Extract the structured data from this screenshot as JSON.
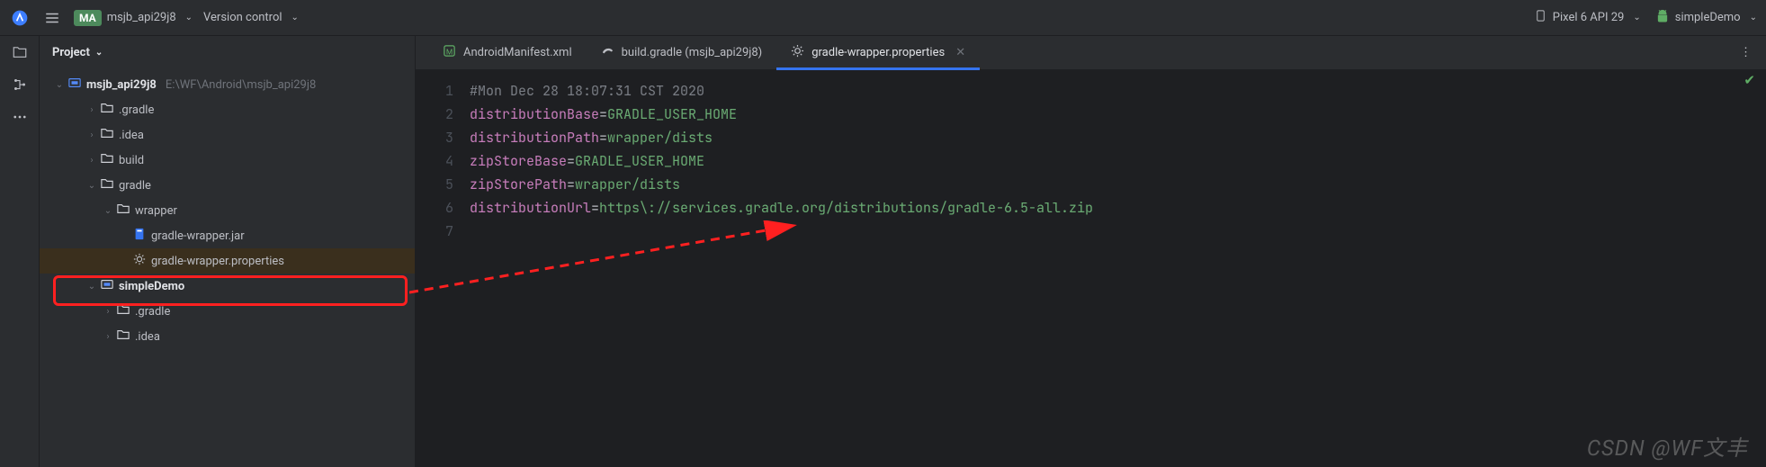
{
  "topbar": {
    "project_badge": "MA",
    "project_name": "msjb_api29j8",
    "version_control": "Version control",
    "device": "Pixel 6 API 29",
    "run_config": "simpleDemo"
  },
  "sidebar": {
    "title": "Project",
    "root": {
      "label": "msjb_api29j8",
      "path": "E:\\WF\\Android\\msjb_api29j8"
    },
    "items": [
      {
        "label": ".gradle",
        "indent": 2,
        "chev": "›",
        "icon": "folder"
      },
      {
        "label": ".idea",
        "indent": 2,
        "chev": "›",
        "icon": "folder"
      },
      {
        "label": "build",
        "indent": 2,
        "chev": "›",
        "icon": "folder"
      },
      {
        "label": "gradle",
        "indent": 2,
        "chev": "⌄",
        "icon": "folder"
      },
      {
        "label": "wrapper",
        "indent": 3,
        "chev": "⌄",
        "icon": "folder"
      },
      {
        "label": "gradle-wrapper.jar",
        "indent": 4,
        "chev": "",
        "icon": "jar"
      },
      {
        "label": "gradle-wrapper.properties",
        "indent": 4,
        "chev": "",
        "icon": "gear",
        "selected": true
      },
      {
        "label": "simpleDemo",
        "indent": 2,
        "chev": "⌄",
        "icon": "module",
        "bold": true
      },
      {
        "label": ".gradle",
        "indent": 3,
        "chev": "›",
        "icon": "folder"
      },
      {
        "label": ".idea",
        "indent": 3,
        "chev": "›",
        "icon": "folder"
      }
    ]
  },
  "tabs": [
    {
      "label": "AndroidManifest.xml",
      "icon": "manifest",
      "active": false
    },
    {
      "label": "build.gradle (msjb_api29j8)",
      "icon": "gradle",
      "active": false
    },
    {
      "label": "gradle-wrapper.properties",
      "icon": "gear",
      "active": true
    }
  ],
  "editor": {
    "lines": [
      {
        "n": 1,
        "tokens": [
          [
            "comment",
            "#Mon Dec 28 18:07:31 CST 2020"
          ]
        ]
      },
      {
        "n": 2,
        "tokens": [
          [
            "key",
            "distributionBase"
          ],
          [
            "equals",
            "="
          ],
          [
            "val",
            "GRADLE_USER_HOME"
          ]
        ]
      },
      {
        "n": 3,
        "tokens": [
          [
            "key",
            "distributionPath"
          ],
          [
            "equals",
            "="
          ],
          [
            "val",
            "wrapper/dists"
          ]
        ]
      },
      {
        "n": 4,
        "tokens": [
          [
            "key",
            "zipStoreBase"
          ],
          [
            "equals",
            "="
          ],
          [
            "val",
            "GRADLE_USER_HOME"
          ]
        ]
      },
      {
        "n": 5,
        "tokens": [
          [
            "key",
            "zipStorePath"
          ],
          [
            "equals",
            "="
          ],
          [
            "val",
            "wrapper/dists"
          ]
        ]
      },
      {
        "n": 6,
        "tokens": [
          [
            "key",
            "distributionUrl"
          ],
          [
            "equals",
            "="
          ],
          [
            "val",
            "https\\://services.gradle.org/distributions/gradle-6.5-all.zip"
          ]
        ]
      },
      {
        "n": 7,
        "tokens": []
      }
    ]
  },
  "watermark": "CSDN @WF文丰",
  "annotation": {
    "color": "#ff2020"
  }
}
